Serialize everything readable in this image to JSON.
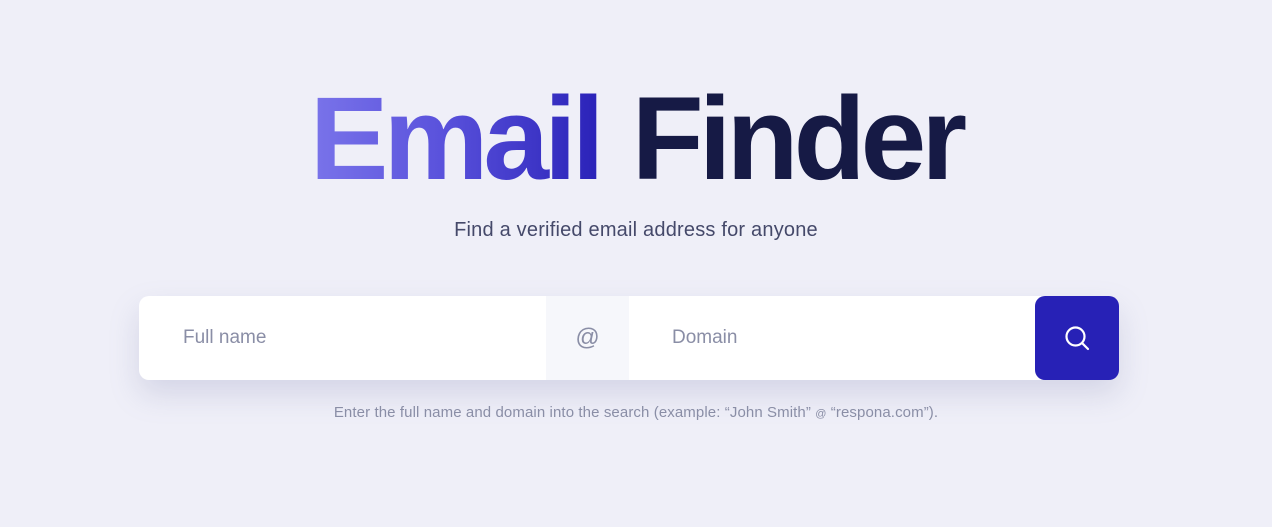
{
  "hero": {
    "title_accent": "Email",
    "title_main": "Finder",
    "subtitle": "Find a verified email address for anyone"
  },
  "search": {
    "name_placeholder": "Full name",
    "at_symbol": "@",
    "domain_placeholder": "Domain",
    "button_icon": "search-icon"
  },
  "hint": {
    "prefix": "Enter the full name and domain into the search (example: “John Smith” ",
    "at_symbol": "@",
    "suffix": " “respona.com”)."
  },
  "colors": {
    "background": "#efeff8",
    "accent": "#2721b6",
    "title_dark": "#161a45",
    "muted_text": "#8a8ea6"
  }
}
